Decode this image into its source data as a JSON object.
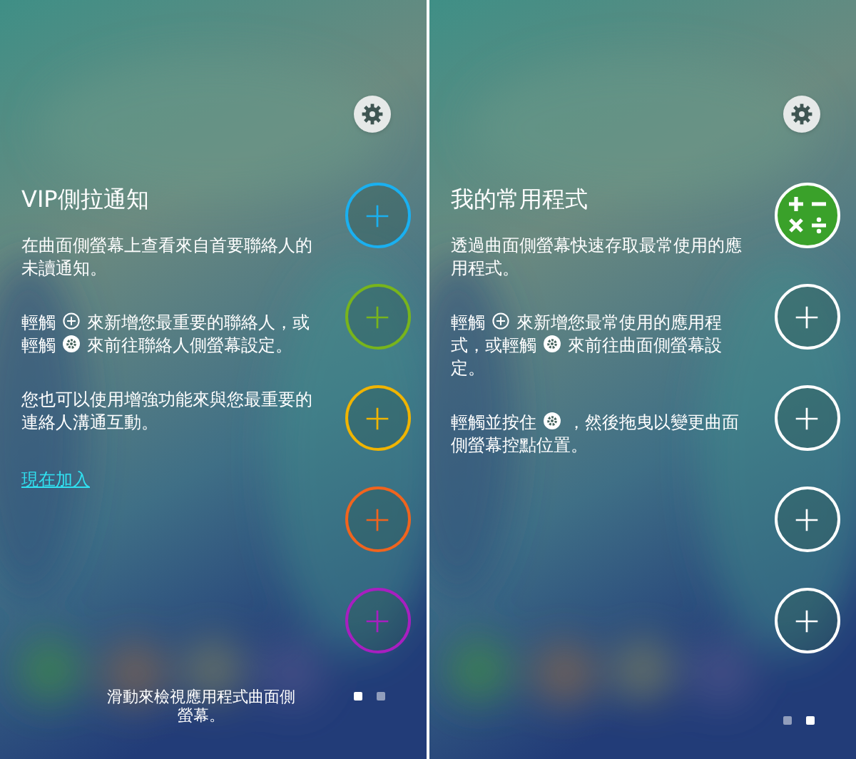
{
  "panels": [
    {
      "title": "VIP側拉通知",
      "paragraphs": [
        [
          {
            "kind": "text",
            "text": "在曲面側螢幕上查看來自首要聯絡人的未讀通知。"
          }
        ],
        [
          {
            "kind": "text",
            "text": "輕觸"
          },
          {
            "kind": "add-icon"
          },
          {
            "kind": "text",
            "text": "來新增您最重要的聯絡人，或輕觸"
          },
          {
            "kind": "settings-icon"
          },
          {
            "kind": "text",
            "text": "來前往聯絡人側螢幕設定。"
          }
        ],
        [
          {
            "kind": "text",
            "text": "您也可以使用增強功能來與您最重要的連絡人溝通互動。"
          }
        ]
      ],
      "link": "現在加入",
      "slots": [
        {
          "kind": "add",
          "color": "#1ab0f0"
        },
        {
          "kind": "add",
          "color": "#78b41c"
        },
        {
          "kind": "add",
          "color": "#f0b400"
        },
        {
          "kind": "add",
          "color": "#f0641e"
        },
        {
          "kind": "add",
          "color": "#a81fc0"
        }
      ],
      "hint": "滑動來檢視應用程式曲面側螢幕。",
      "page_dots": [
        {
          "selected": true
        },
        {
          "selected": false
        }
      ]
    },
    {
      "title": "我的常用程式",
      "paragraphs": [
        [
          {
            "kind": "text",
            "text": "透過曲面側螢幕快速存取最常使用的應用程式。"
          }
        ],
        [
          {
            "kind": "text",
            "text": "輕觸"
          },
          {
            "kind": "add-icon"
          },
          {
            "kind": "text",
            "text": "來新增您最常使用的應用程式，或輕觸"
          },
          {
            "kind": "settings-icon"
          },
          {
            "kind": "text",
            "text": "來前往曲面側螢幕設定。"
          }
        ],
        [
          {
            "kind": "text",
            "text": "輕觸並按住"
          },
          {
            "kind": "settings-icon"
          },
          {
            "kind": "text",
            "text": "，然後拖曳以變更曲面側螢幕控點位置。"
          }
        ]
      ],
      "slots": [
        {
          "kind": "app"
        },
        {
          "kind": "add",
          "color": "#ffffff"
        },
        {
          "kind": "add",
          "color": "#ffffff"
        },
        {
          "kind": "add",
          "color": "#ffffff"
        },
        {
          "kind": "add",
          "color": "#ffffff"
        }
      ],
      "page_dots": [
        {
          "selected": false
        },
        {
          "selected": true
        }
      ]
    }
  ]
}
